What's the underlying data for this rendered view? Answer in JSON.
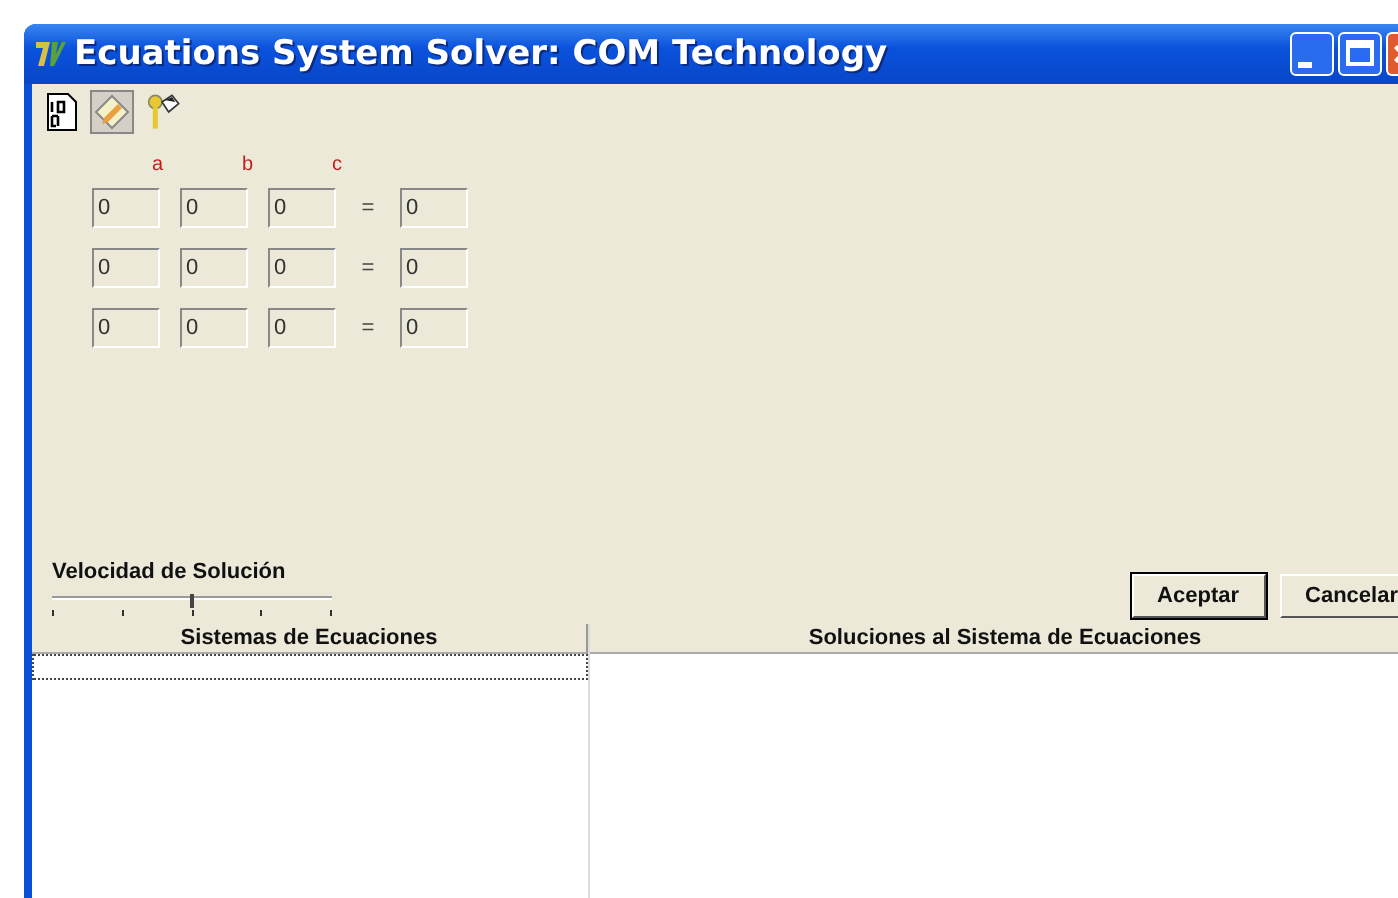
{
  "window": {
    "title": "Ecuations System Solver: COM Technology"
  },
  "matrix": {
    "columns": [
      "a",
      "b",
      "c"
    ],
    "equals": "=",
    "rows": [
      {
        "coefficients": [
          "0",
          "0",
          "0"
        ],
        "result": "0"
      },
      {
        "coefficients": [
          "0",
          "0",
          "0"
        ],
        "result": "0"
      },
      {
        "coefficients": [
          "0",
          "0",
          "0"
        ],
        "result": "0"
      }
    ]
  },
  "speed": {
    "label": "Velocidad de Solución",
    "level": 0.5
  },
  "buttons": [
    "Aceptar",
    "Cancelar"
  ],
  "panels": [
    {
      "header": "Sistemas de Ecuaciones",
      "focused_row": true
    },
    {
      "header": "Soluciones al Sistema de Ecuaciones",
      "focused_row": false
    }
  ]
}
